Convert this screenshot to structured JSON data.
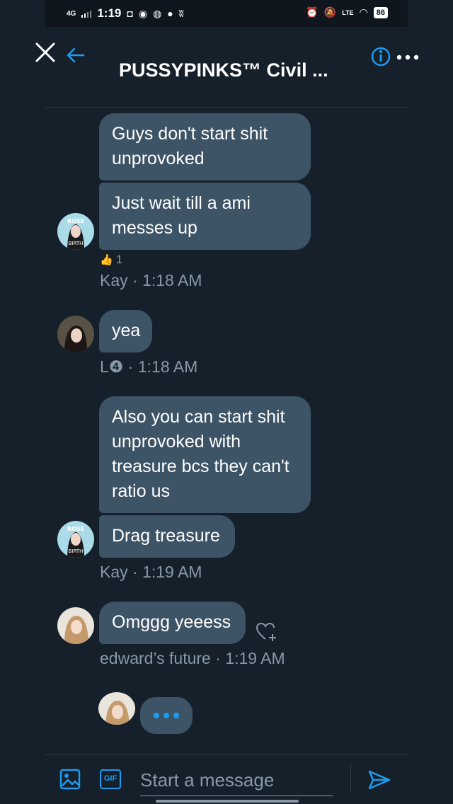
{
  "status_bar": {
    "network": "4G",
    "time": "1:19",
    "lte": "LTE",
    "battery": "86"
  },
  "header": {
    "title": "PUSSYPINKS™ Civil ..."
  },
  "messages": [
    {
      "text": "Guys don't start shit unprovoked"
    },
    {
      "text": "Just wait till a ami messes up",
      "reaction_count": "1",
      "meta": "Kay · 1:18 AM"
    },
    {
      "text": "yea",
      "meta": "L❹ · 1:18 AM"
    },
    {
      "text": "Also you can start shit unprovoked with treasure bcs they can't ratio us"
    },
    {
      "text": "Drag treasure",
      "meta": "Kay · 1:19 AM"
    },
    {
      "text": "Omggg yeeess",
      "meta": "edward’s future · 1:19 AM"
    }
  ],
  "avatar_labels": {
    "kay_top": "ROSE",
    "kay_bottom": "BIRTH"
  },
  "composer": {
    "placeholder": "Start a message",
    "gif_label": "GIF"
  },
  "colors": {
    "accent": "#1d9bf0",
    "background": "#15202b",
    "bubble": "#3d5466",
    "meta": "#8899a6"
  }
}
